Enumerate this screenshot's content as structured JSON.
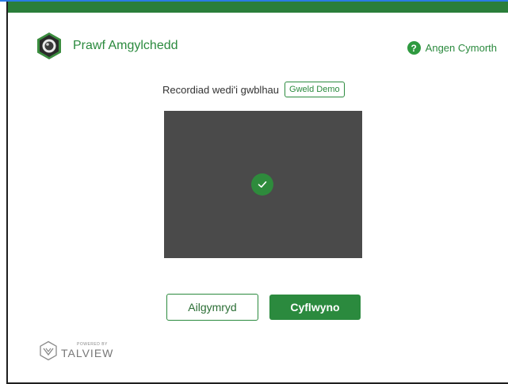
{
  "header": {
    "title": "Prawf Amgylchedd",
    "help_label": "Angen Cymorth",
    "help_glyph": "?"
  },
  "status": {
    "text": "Recordiad wedi'i gwblhau",
    "demo_button_label": "Gweld Demo"
  },
  "actions": {
    "retake_label": "Ailgymryd",
    "submit_label": "Cyflwyno"
  },
  "footer": {
    "powered_by": "POWERED BY",
    "brand": "TALVIEW"
  },
  "icons": {
    "logo": "webcam-icon",
    "help": "question-circle-icon",
    "check": "checkmark-icon",
    "brand": "talview-logo-icon"
  },
  "colors": {
    "accent": "#2b8a3e",
    "top_bar": "#2a7e3a",
    "preview_bg": "#4a4a4a",
    "browser_line": "#2a7be4"
  }
}
